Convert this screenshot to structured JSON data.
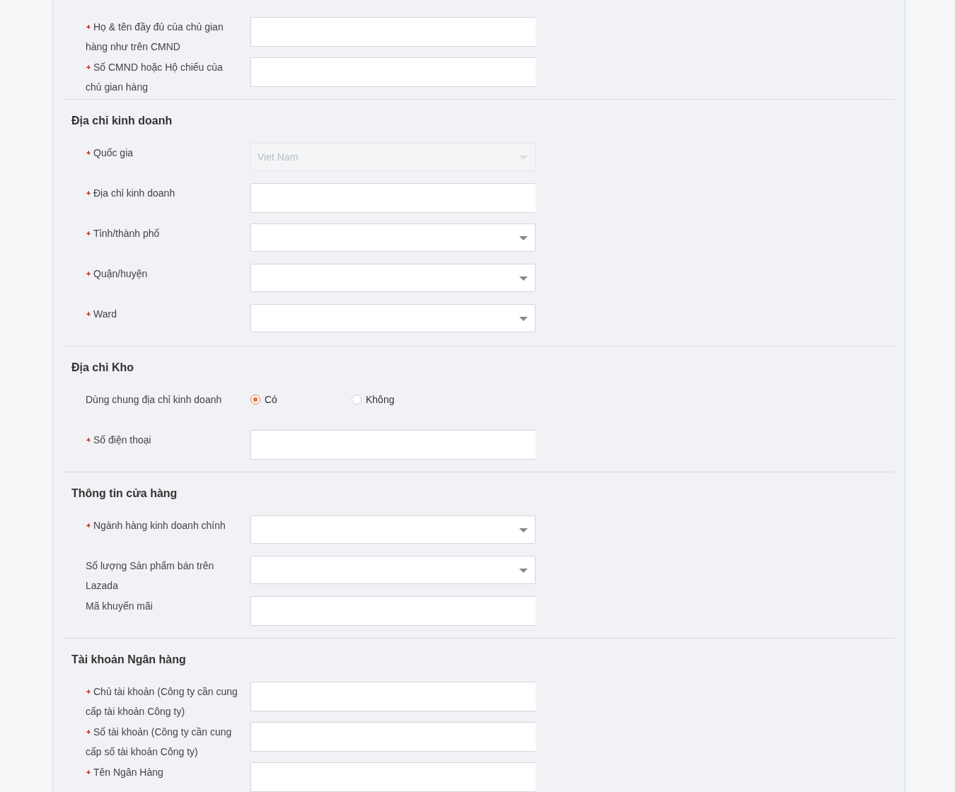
{
  "sections": [
    {
      "fields": [
        {
          "kind": "text",
          "required": true,
          "label": "Họ & tên đầy đủ của chủ gian hàng như trên CMND"
        },
        {
          "kind": "text",
          "required": true,
          "label": "Số CMND hoặc Hộ chiếu của chủ gian hàng"
        }
      ]
    },
    {
      "title": "Địa chỉ kinh doanh",
      "fields": [
        {
          "kind": "select",
          "required": true,
          "disabled": true,
          "label": "Quốc gia",
          "value": "Viet Nam"
        },
        {
          "kind": "text",
          "required": true,
          "label": "Địa chỉ kinh doanh"
        },
        {
          "kind": "select",
          "required": true,
          "disabled": false,
          "label": "Tỉnh/thành phố"
        },
        {
          "kind": "select",
          "required": true,
          "disabled": false,
          "label": "Quận/huyện"
        },
        {
          "kind": "select",
          "required": true,
          "disabled": false,
          "label": "Ward"
        }
      ]
    },
    {
      "title": "Địa chỉ Kho",
      "fields": [
        {
          "kind": "radio",
          "required": false,
          "label": "Dùng chung địa chỉ kinh doanh",
          "options": [
            {
              "label": "Có",
              "selected": true
            },
            {
              "label": "Không",
              "selected": false
            }
          ]
        },
        {
          "kind": "text",
          "required": true,
          "label": "Số điện thoại"
        }
      ]
    },
    {
      "title": "Thông tin cửa hàng",
      "fields": [
        {
          "kind": "select",
          "required": true,
          "disabled": false,
          "label": "Ngành hàng kinh doanh chính"
        },
        {
          "kind": "select",
          "required": false,
          "disabled": false,
          "label": "Số lượng Sản phẩm bán trên Lazada"
        },
        {
          "kind": "text",
          "required": false,
          "label": "Mã khuyến mãi"
        }
      ]
    },
    {
      "title": "Tài khoản Ngân hàng",
      "fields": [
        {
          "kind": "text",
          "required": true,
          "label": "Chủ tài khoản (Công ty cần cung cấp tài khoản Công ty)"
        },
        {
          "kind": "text",
          "required": true,
          "label": "Số tài khoản (Công ty cần cung cấp số tài khoản Công ty)"
        },
        {
          "kind": "text",
          "required": true,
          "label": "Tên Ngân Hàng"
        }
      ]
    }
  ]
}
